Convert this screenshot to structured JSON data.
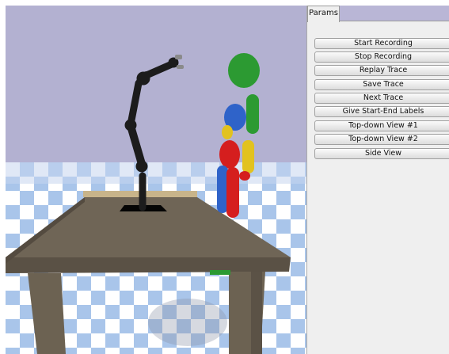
{
  "panel": {
    "tab_label": "Params",
    "buttons": [
      {
        "label": "Start Recording"
      },
      {
        "label": "Stop Recording"
      },
      {
        "label": "Replay Trace"
      },
      {
        "label": "Save Trace"
      },
      {
        "label": "Next Trace"
      },
      {
        "label": "Give Start-End Labels"
      },
      {
        "label": "Top-down View #1"
      },
      {
        "label": "Top-down View #2"
      },
      {
        "label": "Side View"
      }
    ]
  },
  "scene": {
    "sky_color": "#b3b1d1",
    "floor_colors": [
      "#ffffff",
      "#a9c5ea"
    ],
    "table_color": "#6f6556",
    "humanoid_colors": {
      "head": "#2c9a32",
      "torso": "#2f63c9",
      "arm": "#d51e1e",
      "leg": "#e2c21f"
    }
  }
}
